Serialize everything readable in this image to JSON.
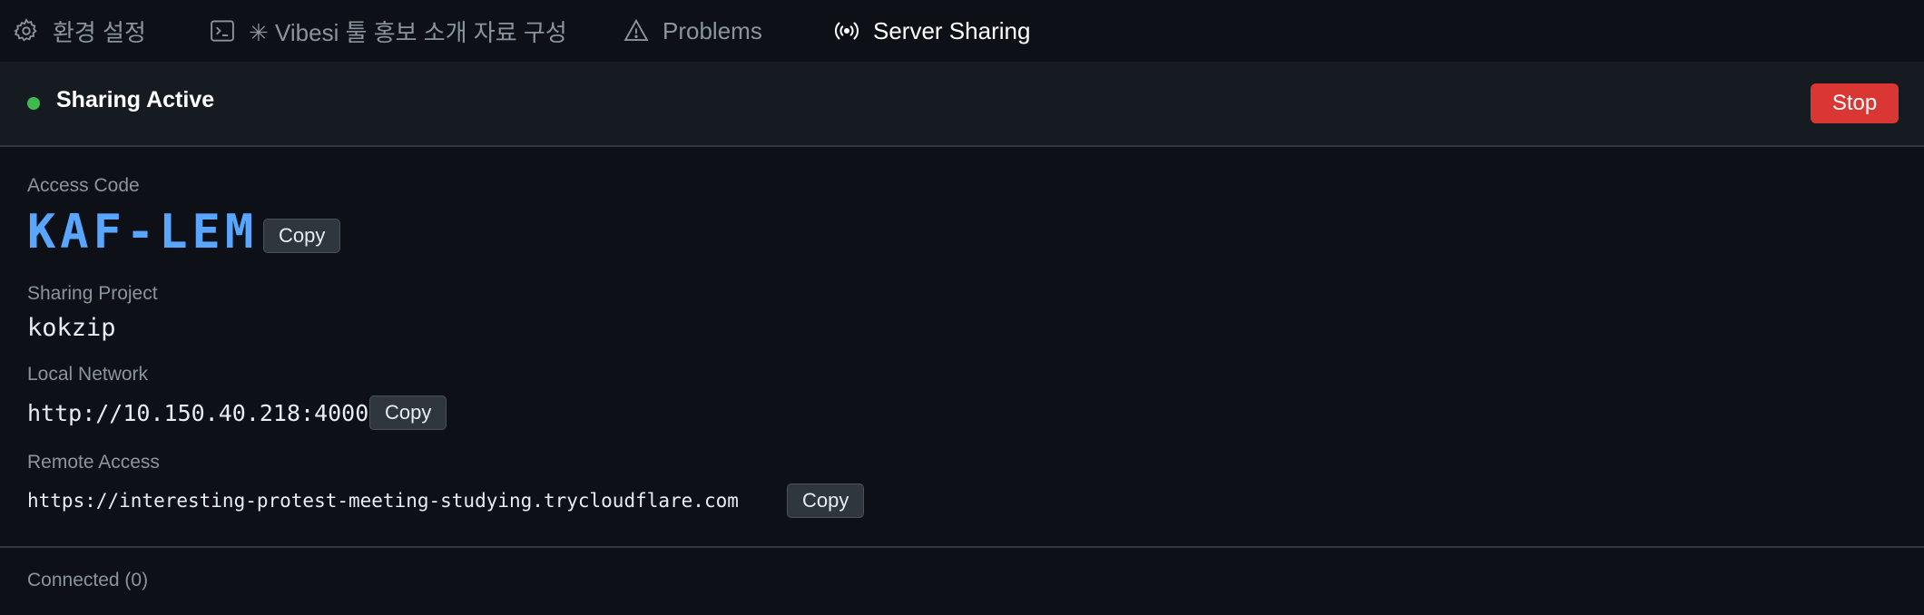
{
  "tabs": [
    {
      "label": "환경 설정",
      "icon": "gear-icon"
    },
    {
      "label": "✳ Vibesi 툴 홍보 소개 자료 구성",
      "icon": "terminal-icon"
    },
    {
      "label": "Problems",
      "icon": "warning-icon"
    },
    {
      "label": "Server Sharing",
      "icon": "broadcast-icon"
    }
  ],
  "status": {
    "text": "Sharing Active",
    "stop_label": "Stop",
    "color": "#3fb950"
  },
  "access": {
    "label": "Access Code",
    "code": "KAF-LEM",
    "copy_label": "Copy"
  },
  "project": {
    "label": "Sharing Project",
    "name": "kokzip"
  },
  "local": {
    "label": "Local Network",
    "url": "http://10.150.40.218:4000",
    "copy_label": "Copy"
  },
  "remote": {
    "label": "Remote Access",
    "url": "https://interesting-protest-meeting-studying.trycloudflare.com",
    "copy_label": "Copy"
  },
  "connected": {
    "text": "Connected (0)"
  },
  "colors": {
    "accent": "#58a6ff",
    "danger": "#da3633",
    "background": "#0d1117"
  }
}
